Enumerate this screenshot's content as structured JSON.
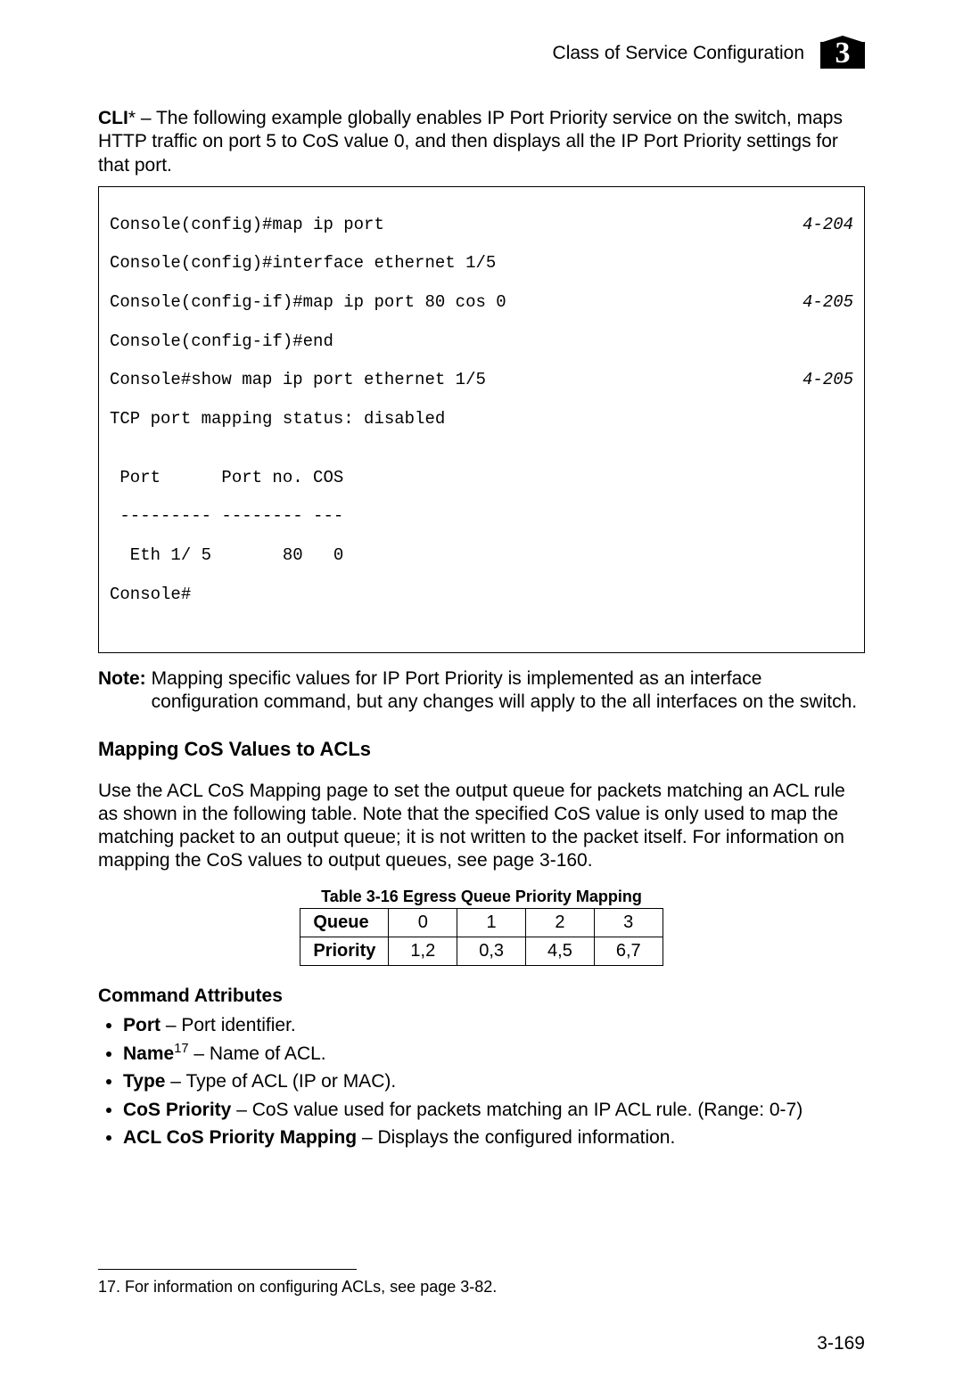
{
  "header": {
    "title": "Class of Service Configuration",
    "chapter_num": "3"
  },
  "cli_intro": {
    "label": "CLI",
    "asterisk": "*",
    "text": " – The following example globally enables IP Port Priority service on the switch, maps HTTP traffic on port 5 to CoS value 0, and then displays all the IP Port Priority settings for that port."
  },
  "code": {
    "l1": "Console(config)#map ip port",
    "r1": "4-204",
    "l2": "Console(config)#interface ethernet 1/5",
    "l3": "Console(config-if)#map ip port 80 cos 0",
    "r3": "4-205",
    "l4": "Console(config-if)#end",
    "l5": "Console#show map ip port ethernet 1/5",
    "r5": "4-205",
    "l6": "TCP port mapping status: disabled",
    "l7": "",
    "l8": " Port      Port no. COS",
    "l9": " --------- -------- ---",
    "l10": "  Eth 1/ 5       80   0",
    "l11": "Console#"
  },
  "note": {
    "label": "Note:",
    "text": "Mapping specific values for IP Port Priority is implemented as an interface configuration command, but any changes will apply to the all interfaces on the switch."
  },
  "section_heading": "Mapping CoS Values to ACLs",
  "section_para": "Use the ACL CoS Mapping page to set the output queue for packets matching an ACL rule as shown in the following table. Note that the specified CoS value is only used to map the matching packet to an output queue; it is not written to the packet itself. For information on mapping the CoS values to output queues, see page 3-160.",
  "table_caption": "Table 3-16  Egress Queue Priority Mapping",
  "chart_data": {
    "type": "table",
    "row_labels": [
      "Queue",
      "Priority"
    ],
    "columns": [
      "0",
      "1",
      "2",
      "3"
    ],
    "rows": {
      "Queue": [
        "0",
        "1",
        "2",
        "3"
      ],
      "Priority": [
        "1,2",
        "0,3",
        "4,5",
        "6,7"
      ]
    }
  },
  "cmd_attr_heading": "Command Attributes",
  "attrs": {
    "port_b": "Port",
    "port_t": " – Port identifier.",
    "name_b": "Name",
    "name_sup": "17",
    "name_t": " – Name of ACL.",
    "type_b": "Type",
    "type_t": " – Type of ACL (IP or MAC).",
    "cosp_b": "CoS Priority",
    "cosp_t": " – CoS value used for packets matching an IP ACL rule. (Range: 0-7)",
    "aclm_b": "ACL CoS Priority Mapping",
    "aclm_t": " – Displays the configured information."
  },
  "footnote": "17. For information on configuring ACLs, see page 3-82.",
  "page_number": "3-169"
}
